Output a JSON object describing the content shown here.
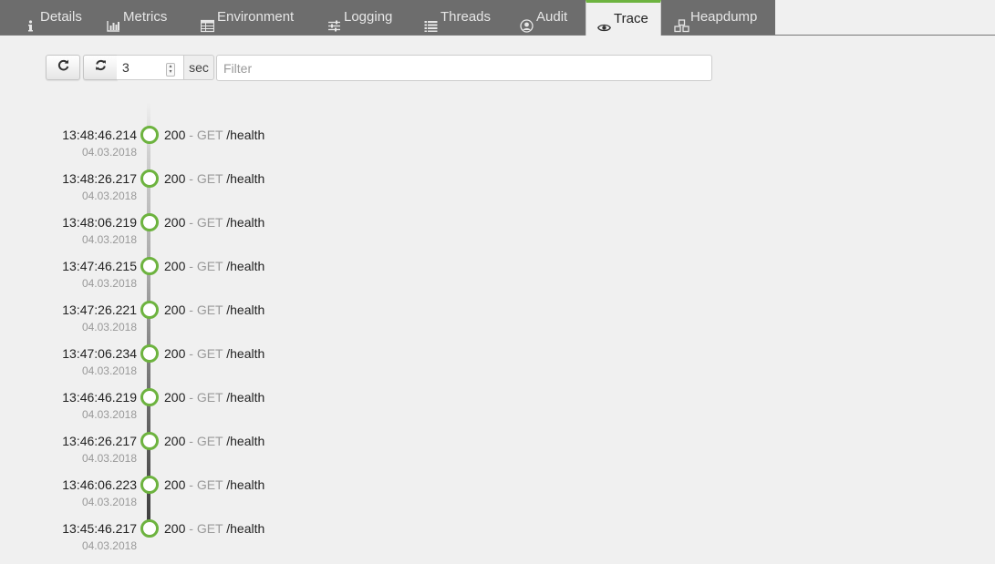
{
  "tabs": [
    {
      "label": "Details",
      "icon": "info-icon"
    },
    {
      "label": "Metrics",
      "icon": "bar-chart-icon"
    },
    {
      "label": "Environment",
      "icon": "table-icon"
    },
    {
      "label": "Logging",
      "icon": "sliders-icon"
    },
    {
      "label": "Threads",
      "icon": "list-icon"
    },
    {
      "label": "Audit",
      "icon": "user-circle-icon"
    },
    {
      "label": "Trace",
      "icon": "eye-icon",
      "active": true
    },
    {
      "label": "Heapdump",
      "icon": "cubes-icon"
    }
  ],
  "toolbar": {
    "interval_value": "3",
    "interval_unit": "sec",
    "filter_placeholder": "Filter"
  },
  "colors": {
    "accent": "#6db33f",
    "tab_bar": "#6d6d6d",
    "background": "#f0f0f0"
  },
  "traces": [
    {
      "time": "13:48:46.214",
      "date": "04.03.2018",
      "status": "200",
      "sep": " - ",
      "method": "GET",
      "path": "/health"
    },
    {
      "time": "13:48:26.217",
      "date": "04.03.2018",
      "status": "200",
      "sep": " - ",
      "method": "GET",
      "path": "/health"
    },
    {
      "time": "13:48:06.219",
      "date": "04.03.2018",
      "status": "200",
      "sep": " - ",
      "method": "GET",
      "path": "/health"
    },
    {
      "time": "13:47:46.215",
      "date": "04.03.2018",
      "status": "200",
      "sep": " - ",
      "method": "GET",
      "path": "/health"
    },
    {
      "time": "13:47:26.221",
      "date": "04.03.2018",
      "status": "200",
      "sep": " - ",
      "method": "GET",
      "path": "/health"
    },
    {
      "time": "13:47:06.234",
      "date": "04.03.2018",
      "status": "200",
      "sep": " - ",
      "method": "GET",
      "path": "/health"
    },
    {
      "time": "13:46:46.219",
      "date": "04.03.2018",
      "status": "200",
      "sep": " - ",
      "method": "GET",
      "path": "/health"
    },
    {
      "time": "13:46:26.217",
      "date": "04.03.2018",
      "status": "200",
      "sep": " - ",
      "method": "GET",
      "path": "/health"
    },
    {
      "time": "13:46:06.223",
      "date": "04.03.2018",
      "status": "200",
      "sep": " - ",
      "method": "GET",
      "path": "/health"
    },
    {
      "time": "13:45:46.217",
      "date": "04.03.2018",
      "status": "200",
      "sep": " - ",
      "method": "GET",
      "path": "/health"
    }
  ]
}
